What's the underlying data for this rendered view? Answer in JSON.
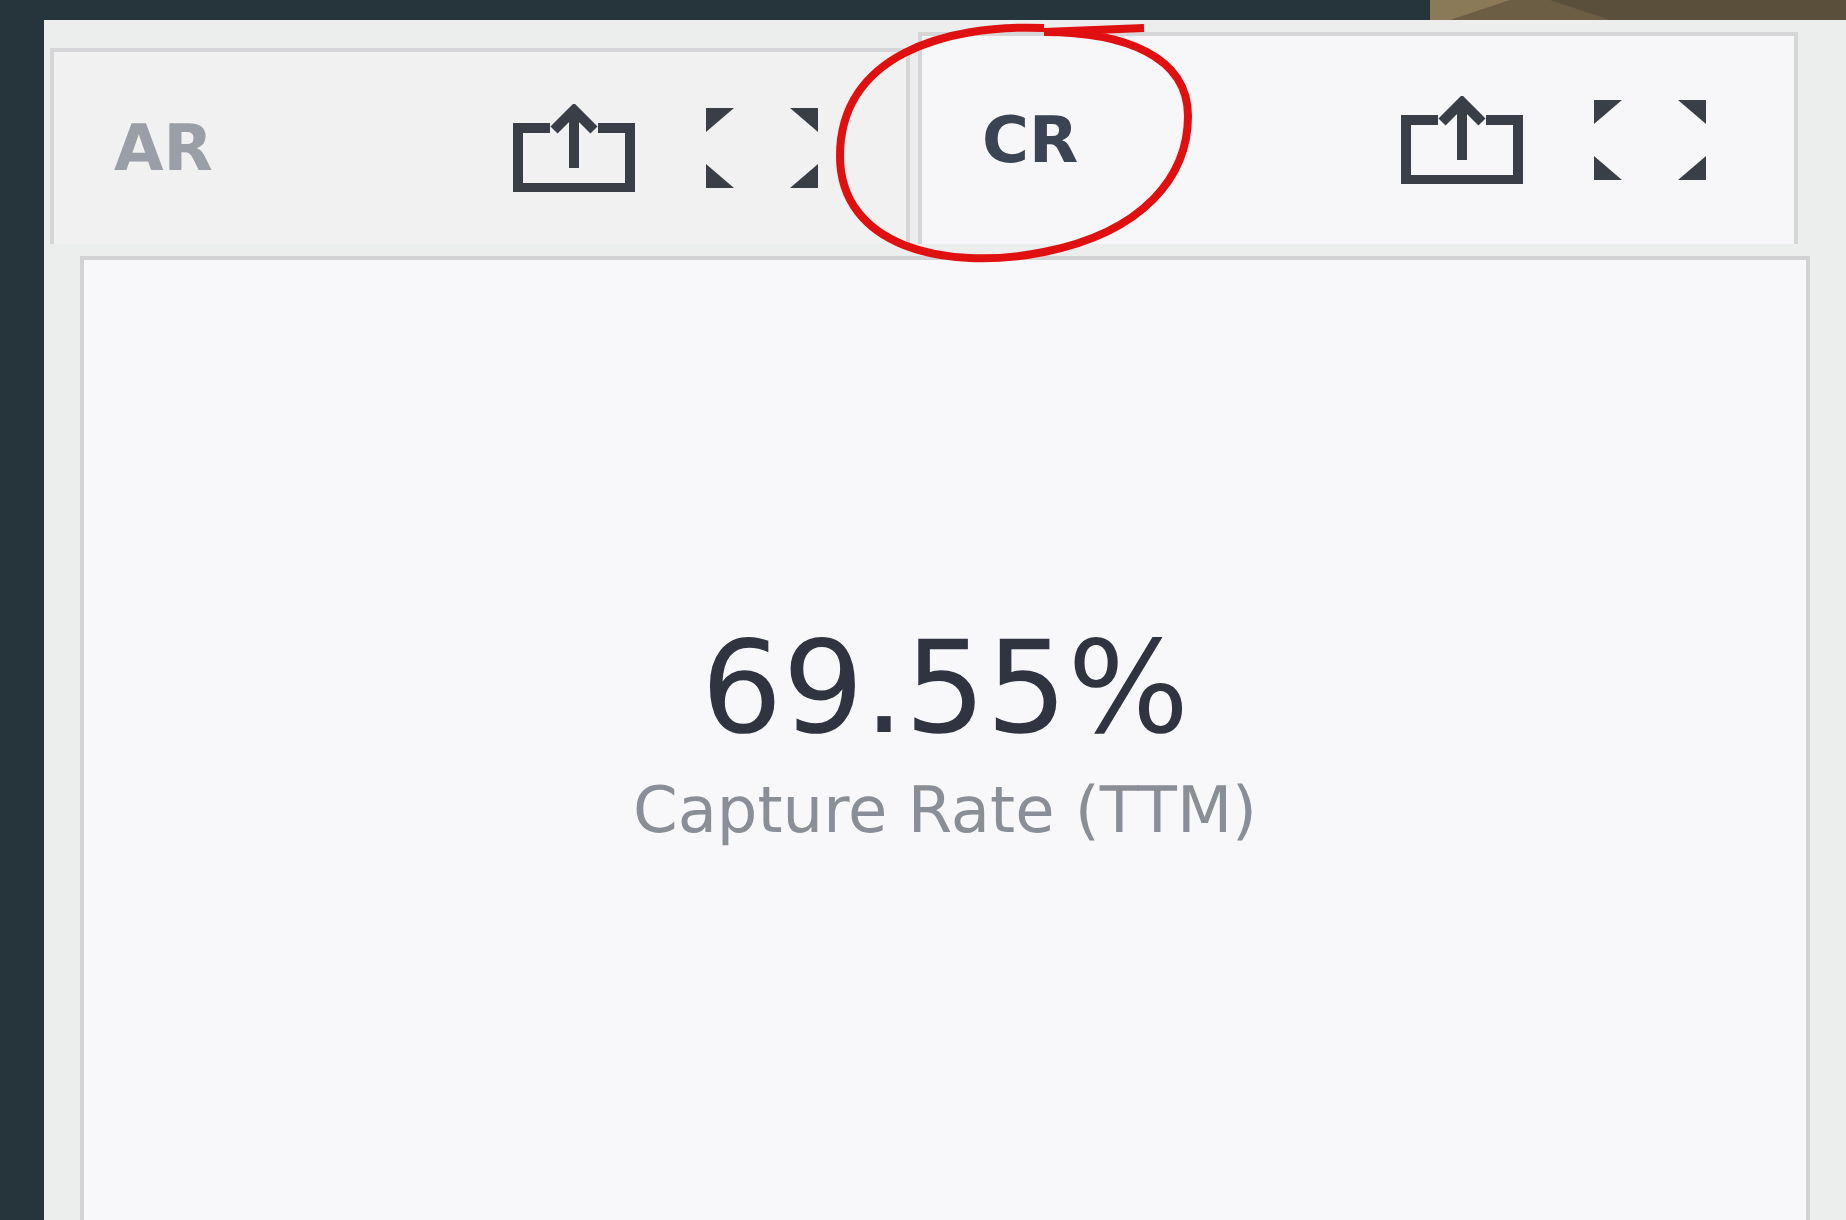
{
  "tabs": [
    {
      "label": "AR",
      "selected": false
    },
    {
      "label": "CR",
      "selected": true
    }
  ],
  "metric": {
    "value": "69.55%",
    "caption": "Capture Rate (TTM)"
  }
}
